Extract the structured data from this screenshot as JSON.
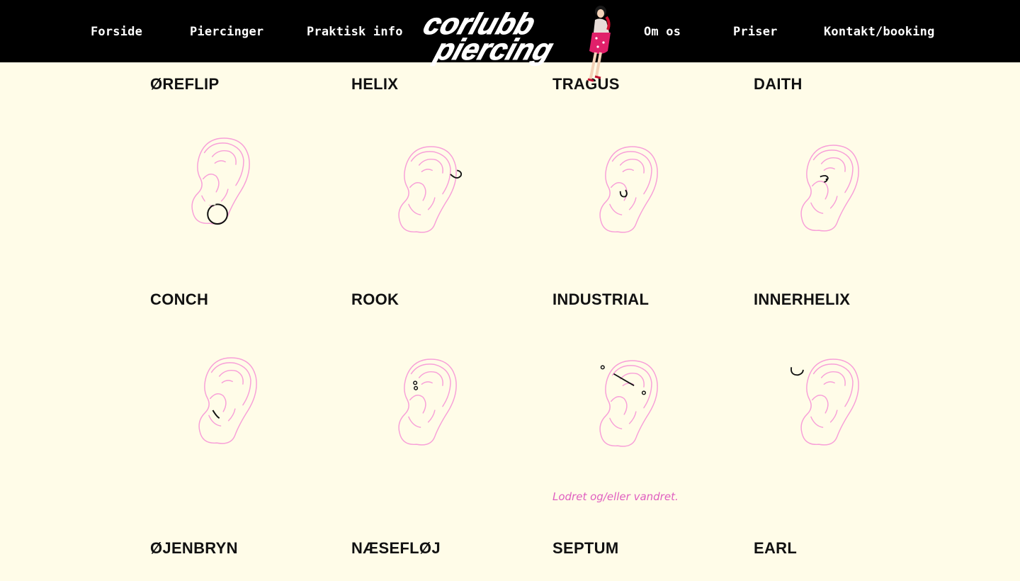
{
  "nav": {
    "left": [
      "Forside",
      "Piercinger",
      "Praktisk info"
    ],
    "right": [
      "Om os",
      "Priser",
      "Kontakt/booking"
    ]
  },
  "logo": {
    "line1": "corlubb",
    "line2": "piercing"
  },
  "piercings": [
    {
      "title": "ØREFLIP",
      "jewelry": "ring-lobe"
    },
    {
      "title": "HELIX",
      "jewelry": "ring-helix"
    },
    {
      "title": "TRAGUS",
      "jewelry": "ring-tragus"
    },
    {
      "title": "DAITH",
      "jewelry": "ring-daith"
    },
    {
      "title": "CONCH",
      "jewelry": "ring-conch"
    },
    {
      "title": "ROOK",
      "jewelry": "barbell-rook"
    },
    {
      "title": "INDUSTRIAL",
      "jewelry": "bar-industrial",
      "note": "Lodret og/eller vandret."
    },
    {
      "title": "INNERHELIX",
      "jewelry": "ring-innerhelix"
    },
    {
      "title": "ØJENBRYN"
    },
    {
      "title": "NÆSEFLØJ"
    },
    {
      "title": "SEPTUM"
    },
    {
      "title": "EARL"
    }
  ],
  "colors": {
    "ear": "#f8a0d8",
    "jewelry": "#111111",
    "note": "#e05fc0",
    "background": "#fffce8",
    "topbar": "#000000"
  }
}
